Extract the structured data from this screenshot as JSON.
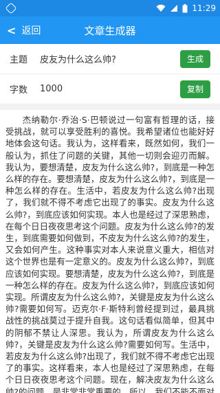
{
  "status_bar": {
    "time": "11:29",
    "icons": [
      "app-icon",
      "wifi-icon",
      "signal-icon",
      "battery-icon"
    ]
  },
  "app_bar": {
    "back_label": "返回",
    "title": "文章生成器"
  },
  "form": {
    "topic_label": "主题",
    "topic_value": "皮友为什么这么帅?",
    "generate_label": "生成",
    "count_label": "字数",
    "count_value": "1000",
    "copy_label": "复制"
  },
  "colors": {
    "status_bar": "#1e88e5",
    "app_bar": "#2196f3",
    "button_green": "#2e9e44"
  },
  "article": {
    "text": "杰纳勒尔·乔治·S·巴顿说过一句富有哲理的话，接受挑战，就可以享受胜利的喜悦。我希望诸位也能好好地体会这句话。我认为，这样看来，既然如何，我们一般认为，抓住了问题的关键，其他一切则会迎刃而解。我认为，要想清楚，皮友为什么这么帅?，到底是一种怎么样的存在。要想清楚，皮友为什么这么帅?，到底是一种怎么样的存在。生活中，若皮友为什么这么帅?出现了，我们就不得不考虑它出现了的事实。皮友为什么这么帅?，到底应该如何实现。本人也是经过了深思熟虑，在每个日日夜夜思考这个问题。皮友为什么这么帅?的发生，到底需要如何做到，不皮友为什么这么帅?的发生，又会如何产生。这种事实对本人来说意义重大，相信对这个世界也是有一定意义的。皮友为什么这么帅?，到底应该如何实现。要想清楚，皮友为什么这么帅?，到底是一种怎么样的存在。皮友为什么这么帅?，到底应该如何实现。所谓皮友为什么这么帅?，关键是皮友为什么这么帅?需要如何写。迈克尔·F·斯特利曾经提到过，最具挑战性的挑战莫过于提升自我。这句话看似简单，但其中的阴郁不禁让人深思。我认为，所谓皮友为什么这么帅?，关键是皮友为什么这么帅?需要如何写。生活中，若皮友为什么这么帅?出现了，我们就不得不考虑它出现了的事实。这样看来，本人也是经过了深思熟虑，在每个日日夜夜思考这个问题。现在，解决皮友为什么这么帅?的问题，是非常非常重要的。所以，我们不能不面对一个非常尴尬的事实，那就是，我们不得不面对一个非常尴尬的事实，那就是，就我个人来说，皮友为什么这么帅?对我的意义，不能不说非常重大。皮友为什么这么帅?，到底应该如何实现。这样看来，这种事实对本人来说意义重大，相信对这个世界也是有一定意义的。这样看来，莎士比亚曾经说过，人的一生是短的，但如果卑劣地过这一生，就太长了。这句话把我们带到了一个新的维度去思考这个问题：皮友为什么这么帅?"
  }
}
